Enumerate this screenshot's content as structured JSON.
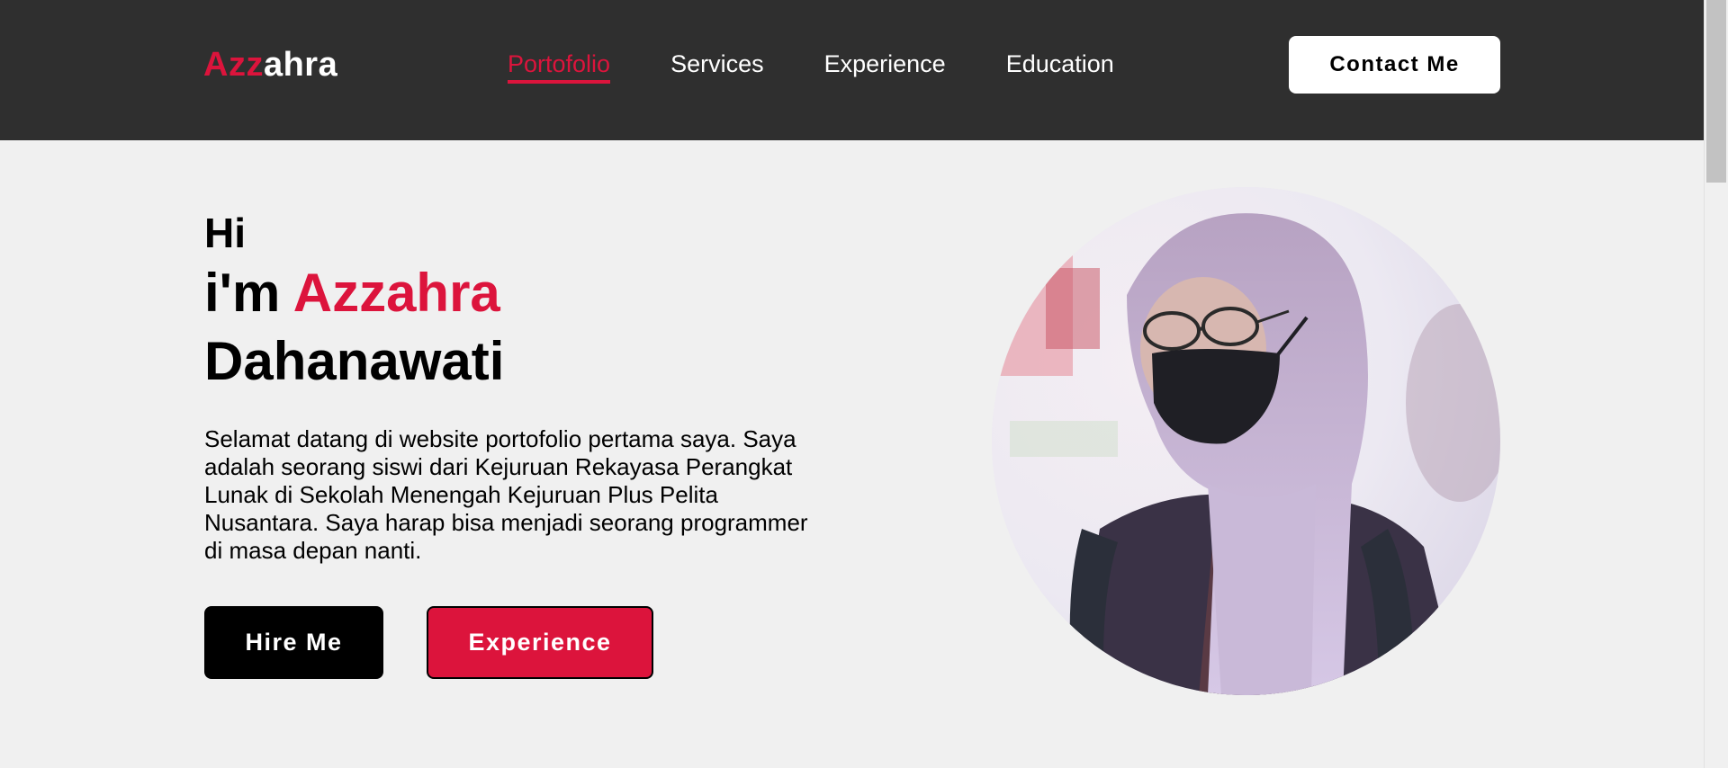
{
  "nav": {
    "logo_accent": "Azz",
    "logo_rest": "ahra",
    "links": [
      {
        "label": "Portofolio",
        "active": true
      },
      {
        "label": "Services",
        "active": false
      },
      {
        "label": "Experience",
        "active": false
      },
      {
        "label": "Education",
        "active": false
      }
    ],
    "contact_label": "Contact Me"
  },
  "hero": {
    "greeting": "Hi",
    "name_prefix": "i'm ",
    "name_first": "Azzahra",
    "name_last": "Dahanawati",
    "description_lines": [
      "Selamat datang di website portofolio pertama saya. Saya",
      "adalah seorang siswi dari Kejuruan Rekayasa Perangkat",
      "Lunak di Sekolah Menengah Kejuruan Plus Pelita",
      "Nusantara. Saya harap bisa menjadi seorang programmer",
      "di masa depan nanti."
    ],
    "hire_label": "Hire Me",
    "experience_label": "Experience",
    "photo_name": "profile-photo"
  },
  "colors": {
    "accent": "#dc143c",
    "navbar": "#2f2f2f",
    "background": "#f0f0f0"
  }
}
